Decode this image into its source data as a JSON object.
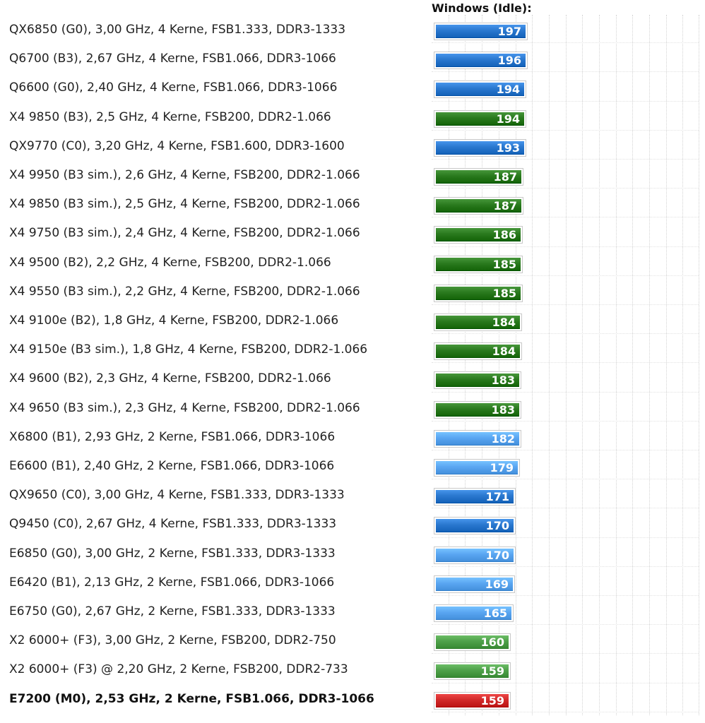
{
  "chart_data": {
    "type": "bar",
    "orientation": "horizontal",
    "title": "Windows (Idle):",
    "xlim": [
      0,
      280
    ],
    "grid": true,
    "colors": {
      "intel_quad": "#2a78cf",
      "intel_dual": "#5aa6f2",
      "amd_x4": "#2a7a1e",
      "amd_x2": "#4fa14a",
      "highlight": "#d22a2a"
    },
    "categories": [
      "QX6850 (G0), 3,00 GHz, 4 Kerne, FSB1.333, DDR3-1333",
      "Q6700 (B3), 2,67 GHz, 4 Kerne, FSB1.066, DDR3-1066",
      "Q6600 (G0), 2,40 GHz, 4 Kerne, FSB1.066, DDR3-1066",
      "X4 9850 (B3), 2,5 GHz, 4 Kerne, FSB200, DDR2-1.066",
      "QX9770 (C0), 3,20 GHz, 4 Kerne, FSB1.600, DDR3-1600",
      "X4 9950 (B3 sim.), 2,6 GHz, 4 Kerne, FSB200, DDR2-1.066",
      "X4 9850 (B3 sim.), 2,5 GHz, 4 Kerne, FSB200, DDR2-1.066",
      "X4 9750 (B3 sim.), 2,4 GHz, 4 Kerne, FSB200, DDR2-1.066",
      "X4 9500 (B2), 2,2 GHz, 4 Kerne, FSB200, DDR2-1.066",
      "X4 9550 (B3 sim.), 2,2 GHz, 4 Kerne, FSB200, DDR2-1.066",
      "X4 9100e (B2), 1,8 GHz, 4 Kerne, FSB200, DDR2-1.066",
      "X4 9150e (B3 sim.), 1,8 GHz, 4 Kerne, FSB200, DDR2-1.066",
      "X4 9600 (B2), 2,3 GHz, 4 Kerne, FSB200, DDR2-1.066",
      "X4 9650 (B3 sim.), 2,3 GHz, 4 Kerne, FSB200, DDR2-1.066",
      "X6800 (B1), 2,93 GHz, 2 Kerne, FSB1.066, DDR3-1066",
      "E6600 (B1), 2,40 GHz, 2 Kerne, FSB1.066, DDR3-1066",
      "QX9650 (C0), 3,00 GHz, 4 Kerne, FSB1.333, DDR3-1333",
      "Q9450 (C0), 2,67 GHz, 4 Kerne, FSB1.333, DDR3-1333",
      "E6850 (G0), 3,00 GHz, 2 Kerne, FSB1.333, DDR3-1333",
      "E6420 (B1), 2,13 GHz, 2 Kerne, FSB1.066, DDR3-1066",
      "E6750 (G0), 2,67 GHz, 2 Kerne, FSB1.333, DDR3-1333",
      "X2 6000+ (F3), 3,00 GHz, 2 Kerne, FSB200, DDR2-750",
      "X2 6000+ (F3) @ 2,20 GHz, 2 Kerne, FSB200, DDR2-733",
      "E7200 (M0), 2,53 GHz, 2 Kerne, FSB1.066, DDR3-1066"
    ],
    "values": [
      197,
      196,
      194,
      194,
      193,
      187,
      187,
      186,
      185,
      185,
      184,
      184,
      183,
      183,
      182,
      179,
      171,
      170,
      170,
      169,
      165,
      160,
      159,
      159
    ],
    "bar_groups": [
      "intel_quad",
      "intel_quad",
      "intel_quad",
      "amd_x4",
      "intel_quad",
      "amd_x4",
      "amd_x4",
      "amd_x4",
      "amd_x4",
      "amd_x4",
      "amd_x4",
      "amd_x4",
      "amd_x4",
      "amd_x4",
      "intel_dual",
      "intel_dual",
      "intel_quad",
      "intel_quad",
      "intel_dual",
      "intel_dual",
      "intel_dual",
      "amd_x2",
      "amd_x2",
      "highlight"
    ],
    "highlighted_index": 23
  }
}
